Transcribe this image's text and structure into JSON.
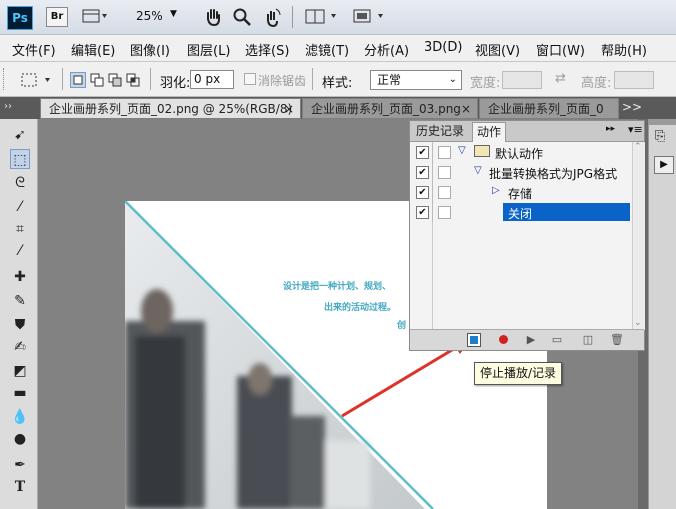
{
  "app": {
    "logo": "Ps",
    "bridge": "Br",
    "zoom": "25%"
  },
  "menu": {
    "items": [
      "文件(F)",
      "编辑(E)",
      "图像(I)",
      "图层(L)",
      "选择(S)",
      "滤镜(T)",
      "分析(A)",
      "3D(D)",
      "视图(V)",
      "窗口(W)",
      "帮助(H)"
    ]
  },
  "options": {
    "feather_label": "羽化:",
    "feather_value": "0 px",
    "antialias_label": "消除锯齿",
    "style_label": "样式:",
    "style_value": "正常",
    "width_label": "宽度:",
    "height_label": "高度:"
  },
  "tabs": [
    {
      "label": "企业画册系列_页面_02.png @ 25%(RGB/8)",
      "close": "×"
    },
    {
      "label": "企业画册系列_页面_03.png",
      "close": "×"
    },
    {
      "label": "企业画册系列_页面_0"
    },
    {
      "label": ">>"
    }
  ],
  "document": {
    "text_line1": "设计是把一种计划、规划、",
    "text_line2": "出来的活动过程。",
    "text_line3": "创"
  },
  "actions_panel": {
    "tab_history": "历史记录",
    "tab_actions": "动作",
    "rows": [
      {
        "label": "默认动作",
        "type": "folder"
      },
      {
        "label": "批量转换格式为JPG格式",
        "type": "action"
      },
      {
        "label": "存储",
        "type": "step"
      },
      {
        "label": "关闭",
        "type": "step-selected"
      }
    ],
    "colors": {
      "selected": "#0a64c8",
      "record": "#d02020",
      "stop": "#1e7fc8"
    }
  },
  "tooltip": "停止播放/记录",
  "icons": {
    "hand": "hand-icon",
    "zoom": "zoom-icon",
    "rotate": "rotate-view-icon",
    "arrange": "arrange-documents-icon",
    "screen": "screen-mode-icon"
  }
}
